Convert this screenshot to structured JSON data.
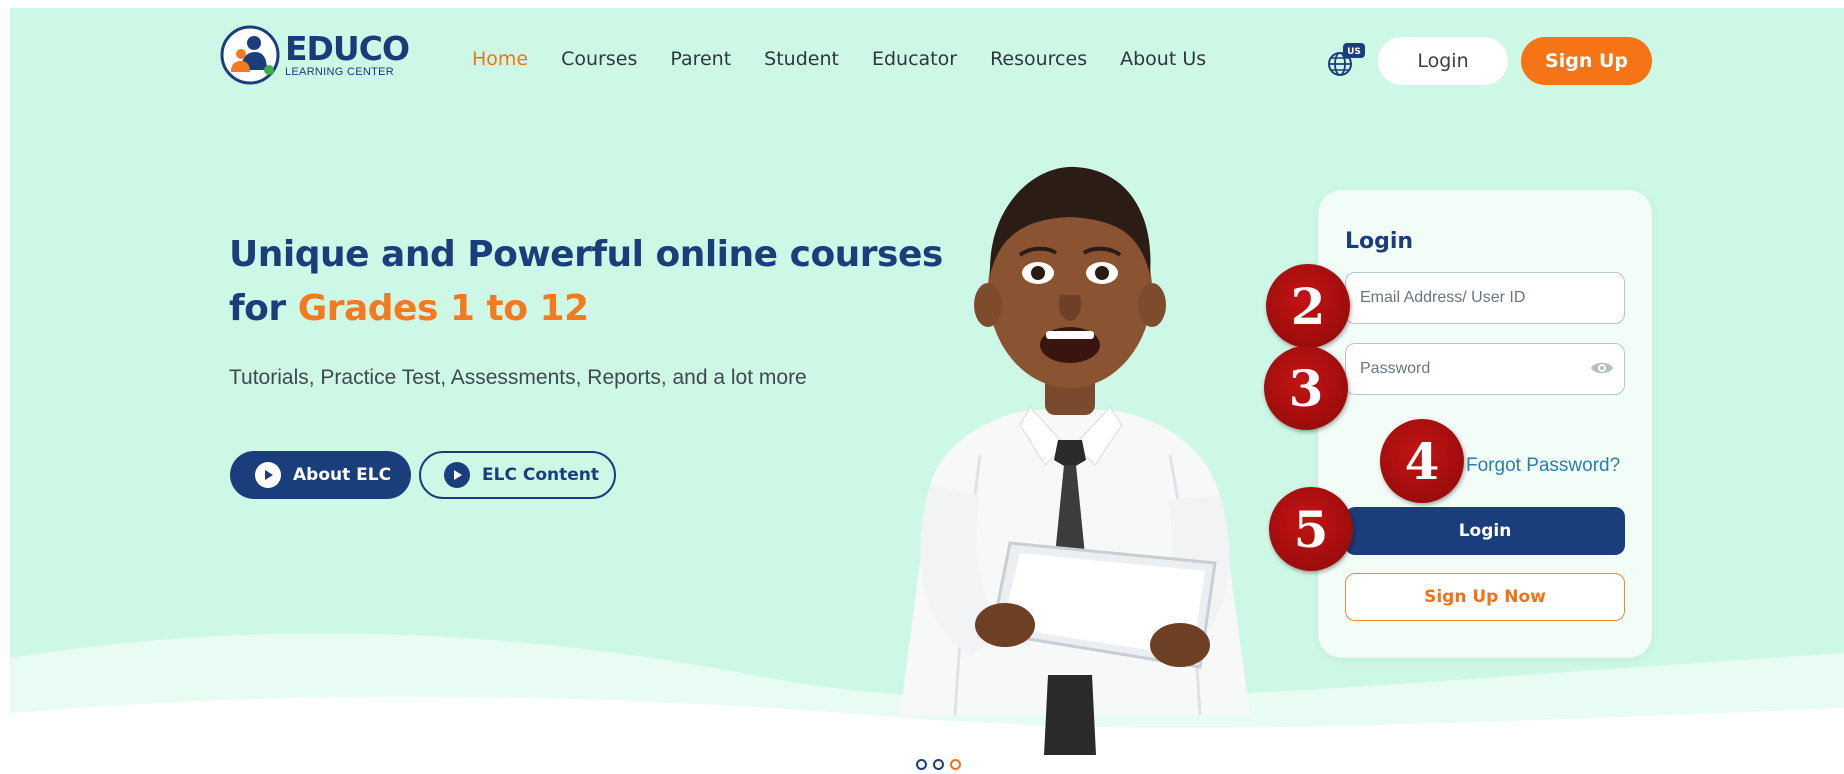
{
  "brand": {
    "name": "EDUCO",
    "subtitle": "LEARNING CENTER"
  },
  "nav": {
    "items": [
      "Home",
      "Courses",
      "Parent",
      "Student",
      "Educator",
      "Resources",
      "About Us"
    ],
    "active": "Home"
  },
  "header": {
    "region_badge": "US",
    "login_label": "Login",
    "signup_label": "Sign Up"
  },
  "hero": {
    "headline_line1": "Unique and Powerful online courses",
    "headline_for": "for ",
    "headline_accent": "Grades 1 to 12",
    "subtext": "Tutorials, Practice Test, Assessments, Reports, and a lot more",
    "about_button": "About ELC",
    "content_button": "ELC Content"
  },
  "login_card": {
    "title": "Login",
    "email_placeholder": "Email Address/ User ID",
    "password_placeholder": "Password",
    "forgot_label": "Forgot Password?",
    "login_button": "Login",
    "signup_button": "Sign Up Now"
  },
  "markers": {
    "email": "2",
    "password": "3",
    "forgot": "4",
    "login": "5"
  },
  "carousel": {
    "slides": 3,
    "active_index": 3
  },
  "colors": {
    "background": "#cdf8e6",
    "primary": "#1a3d7c",
    "accent": "#f67415",
    "link": "#2a7db0",
    "marker": "#a30d0d"
  }
}
